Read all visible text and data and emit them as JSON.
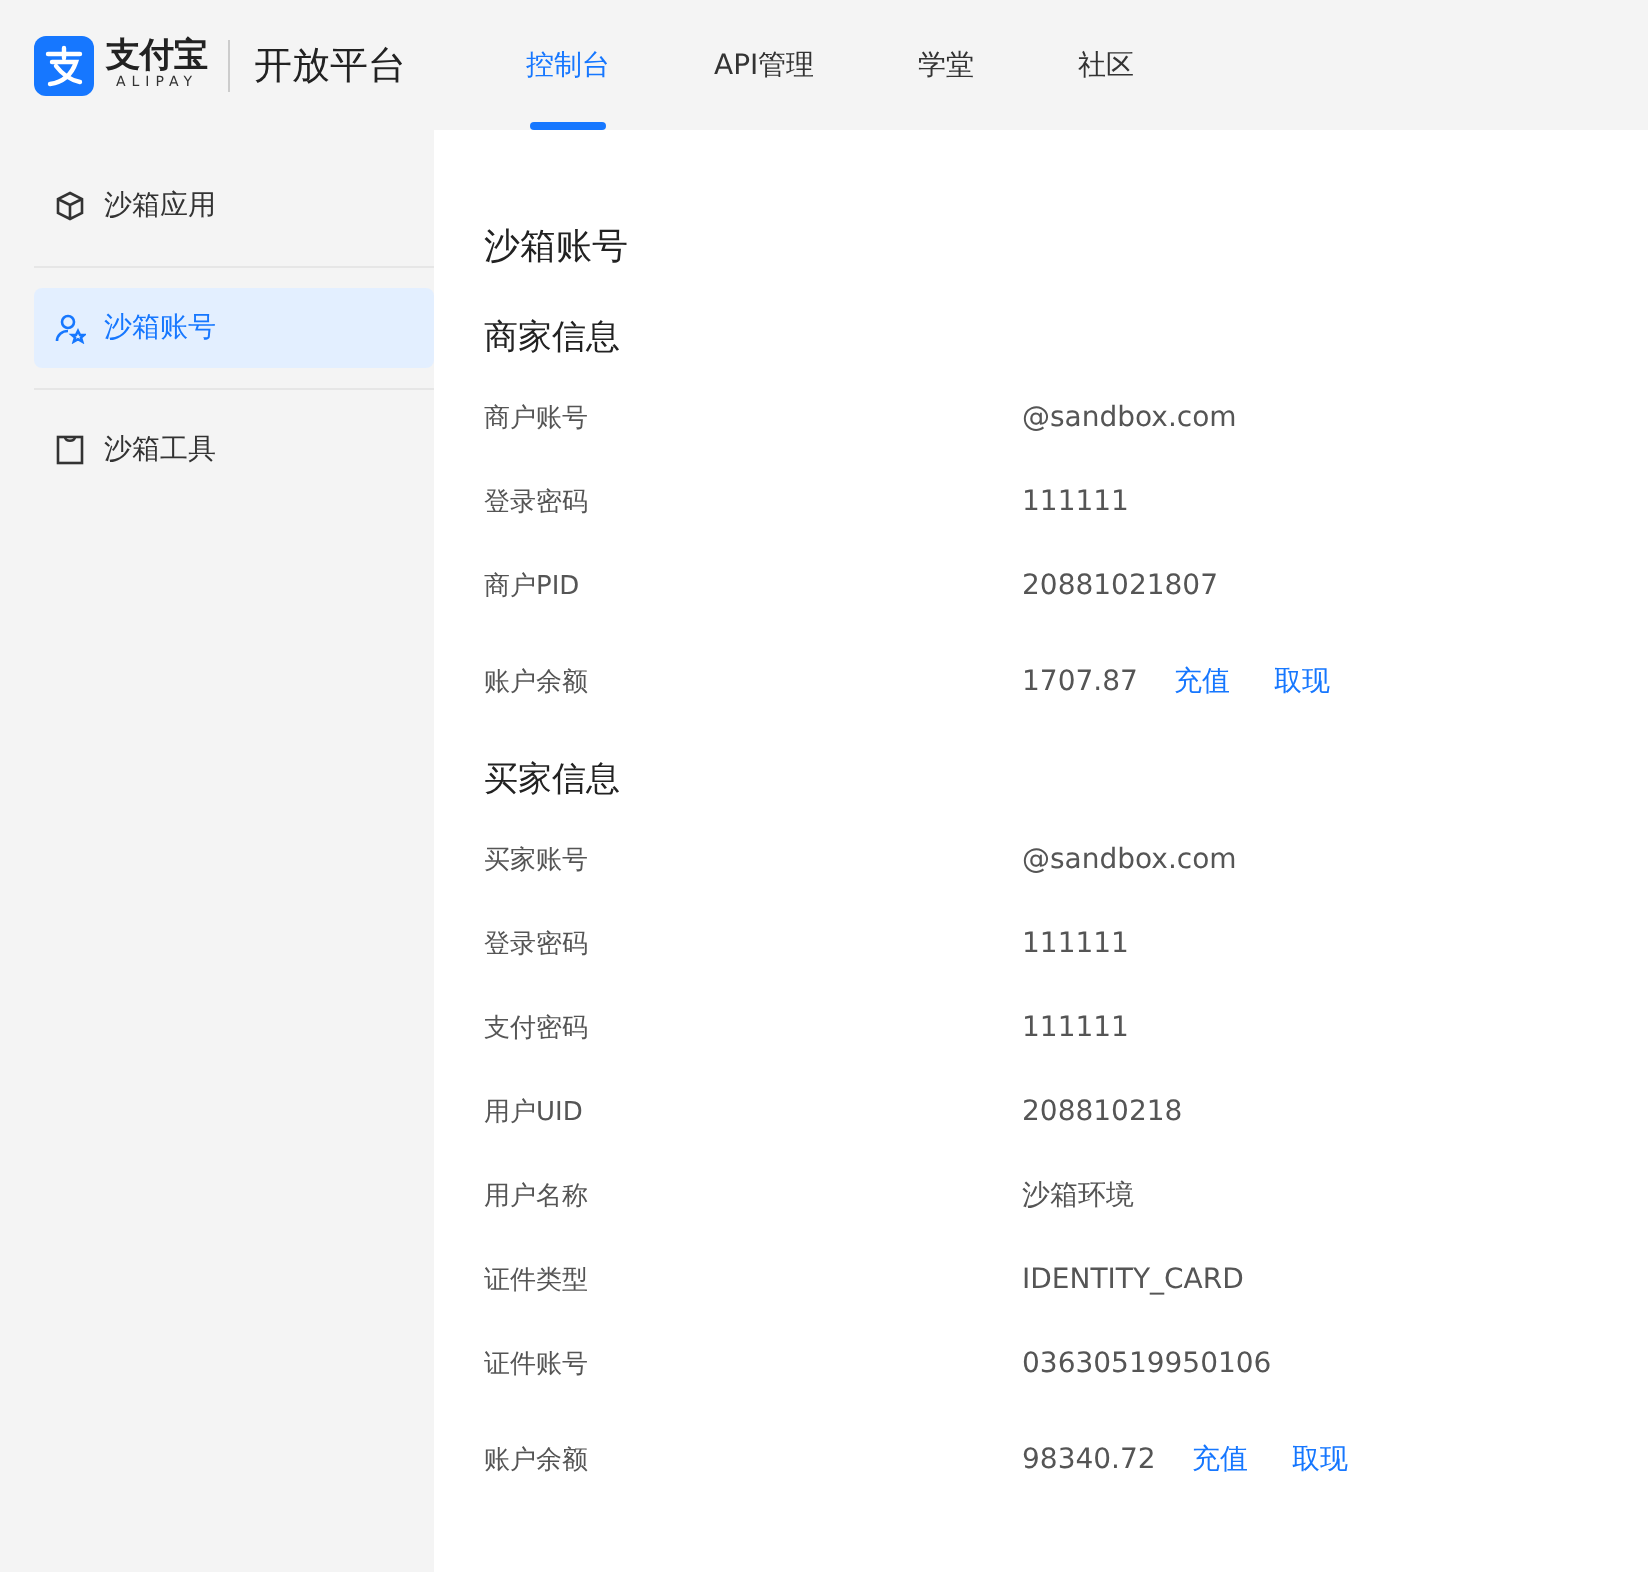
{
  "header": {
    "logo": {
      "brand": "支付宝",
      "brand_sub": "ALIPAY",
      "product": "开放平台"
    },
    "nav": [
      {
        "label": "控制台",
        "selected": true
      },
      {
        "label": "API管理",
        "selected": false
      },
      {
        "label": "学堂",
        "selected": false
      },
      {
        "label": "社区",
        "selected": false
      }
    ]
  },
  "sidebar": {
    "items": [
      {
        "label": "沙箱应用",
        "selected": false
      },
      {
        "label": "沙箱账号",
        "selected": true
      },
      {
        "label": "沙箱工具",
        "selected": false
      }
    ]
  },
  "page_title": "沙箱账号",
  "sections": [
    {
      "title": "商家信息",
      "rows": [
        {
          "kind": "text",
          "label": "商户账号",
          "value": "@sandbox.com"
        },
        {
          "kind": "text",
          "label": "登录密码",
          "value": "111111"
        },
        {
          "kind": "text",
          "label": "商户PID",
          "value": "20881021807"
        },
        {
          "kind": "balance",
          "label": "账户余额",
          "value": "1707.87",
          "actions": [
            "充值",
            "取现"
          ]
        }
      ]
    },
    {
      "title": "买家信息",
      "rows": [
        {
          "kind": "text",
          "label": "买家账号",
          "value": "@sandbox.com"
        },
        {
          "kind": "text",
          "label": "登录密码",
          "value": "111111"
        },
        {
          "kind": "text",
          "label": "支付密码",
          "value": "111111"
        },
        {
          "kind": "text",
          "label": "用户UID",
          "value": "208810218"
        },
        {
          "kind": "text",
          "label": "用户名称",
          "value": "沙箱环境"
        },
        {
          "kind": "text",
          "label": "证件类型",
          "value": "IDENTITY_CARD"
        },
        {
          "kind": "text",
          "label": "证件账号",
          "value": "03630519950106"
        },
        {
          "kind": "balance",
          "label": "账户余额",
          "value": "98340.72",
          "actions": [
            "充值",
            "取现"
          ]
        }
      ]
    }
  ]
}
